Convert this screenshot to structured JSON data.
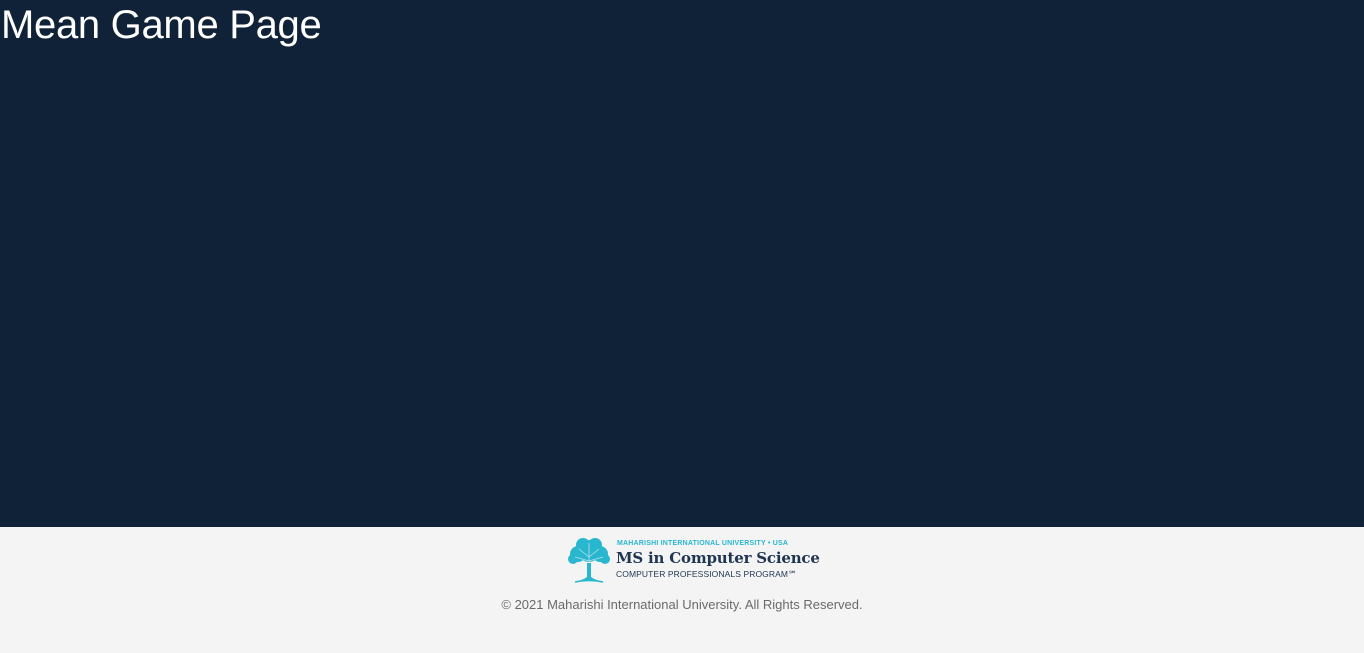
{
  "main": {
    "title": "Mean Game Page",
    "background_color": "#0f2238"
  },
  "footer": {
    "background_color": "#f4f4f4",
    "logo": {
      "icon": "tree-icon",
      "line_top": "MAHARISHI INTERNATIONAL UNIVERSITY • USA",
      "line_main": "MS in Computer Science",
      "line_sub": "COMPUTER PROFESSIONALS PROGRAM℠",
      "accent_color": "#28b7cf",
      "text_color": "#1f3550"
    },
    "copyright": "© 2021 Maharishi International University. All Rights Reserved."
  }
}
